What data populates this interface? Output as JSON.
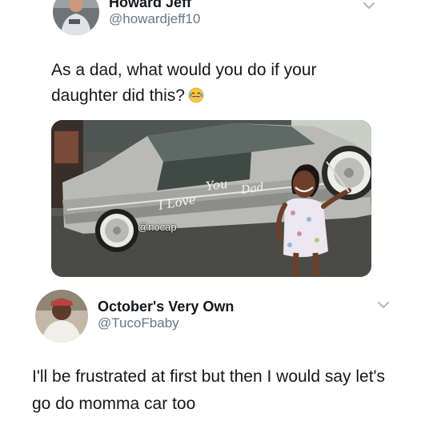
{
  "original_tweet": {
    "display_name": "Howard Jeff",
    "handle": "@howardjeff10",
    "text": "As a dad, what would you do if your daughter did this?",
    "emoji_icon": "face-with-tears-of-joy-icon",
    "media": {
      "watermark": "@nocap",
      "car_writing": {
        "word1": "I Love",
        "word2": "You",
        "word3": "Dad"
      }
    }
  },
  "reply_tweet": {
    "display_name": "October's Very Own",
    "handle": "@TucoFbaby",
    "text": "I'll be frustrated at first but then I would say let's go do momma car too"
  },
  "colors": {
    "text_primary": "#14171a",
    "text_secondary": "#657786",
    "background": "#ffffff"
  }
}
